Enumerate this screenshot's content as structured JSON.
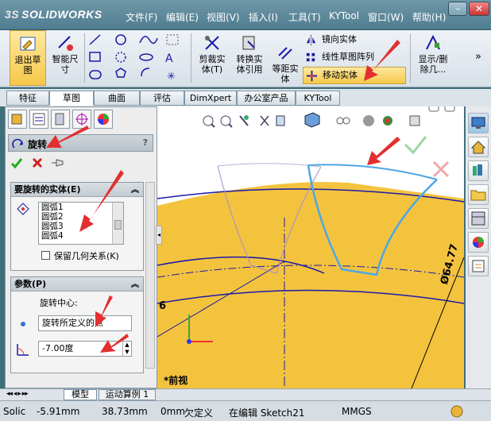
{
  "app": {
    "brand_ds": "3S",
    "brand_name": "SOLIDWORKS"
  },
  "menu": [
    "文件(F)",
    "编辑(E)",
    "视图(V)",
    "插入(I)",
    "工具(T)",
    "KYTool",
    "窗口(W)",
    "帮助(H)"
  ],
  "window_controls": {
    "minimize": "–",
    "restore": "❐",
    "close": "✕"
  },
  "toolbar": {
    "exit_sketch": "退出草\n图",
    "smart_dimension": "智能尺\n寸",
    "trim_entities": "剪裁实\n体(T)",
    "convert_entities": "转换实\n体引用",
    "offset_entities": "等距实\n体",
    "mirror_entities": "镜向实体",
    "linear_pattern": "线性草图阵列",
    "move_entities": "移动实体",
    "display_delete": "显示/删\n除几...",
    "more": "»"
  },
  "tabs": [
    "特征",
    "草图",
    "曲面",
    "评估",
    "DimXpert",
    "办公室产品",
    "KYTool"
  ],
  "property_manager": {
    "title": "旋转",
    "help": "?",
    "entities_group": {
      "header": "要旋转的实体(E)",
      "items": [
        "圆弧1",
        "圆弧2",
        "圆弧3",
        "圆弧4"
      ],
      "keep_relations": "保留几何关系(K)"
    },
    "params_group": {
      "header": "参数(P)",
      "center_label": "旋转中心:",
      "center_value": "旋转所定义的点",
      "angle_value": "-7.00度"
    }
  },
  "graphics": {
    "view_label": "*前视",
    "dimension_left": "6",
    "dimension_right": "Ø64.77"
  },
  "bottom_tabs": [
    "模型",
    "运动算例 1"
  ],
  "status": {
    "app_short": "Solic",
    "x": "-5.91mm",
    "y": "38.73mm",
    "z": "0mm",
    "state": "欠定义",
    "editing": "在编辑 Sketch21",
    "units": "MMGS"
  },
  "colors": {
    "accent": "#c9a13b",
    "part_face": "#f5c84a",
    "sketch_blue": "#1a1aa8",
    "preview_blue": "#4ca6e8",
    "arrow_red": "#e23030"
  }
}
